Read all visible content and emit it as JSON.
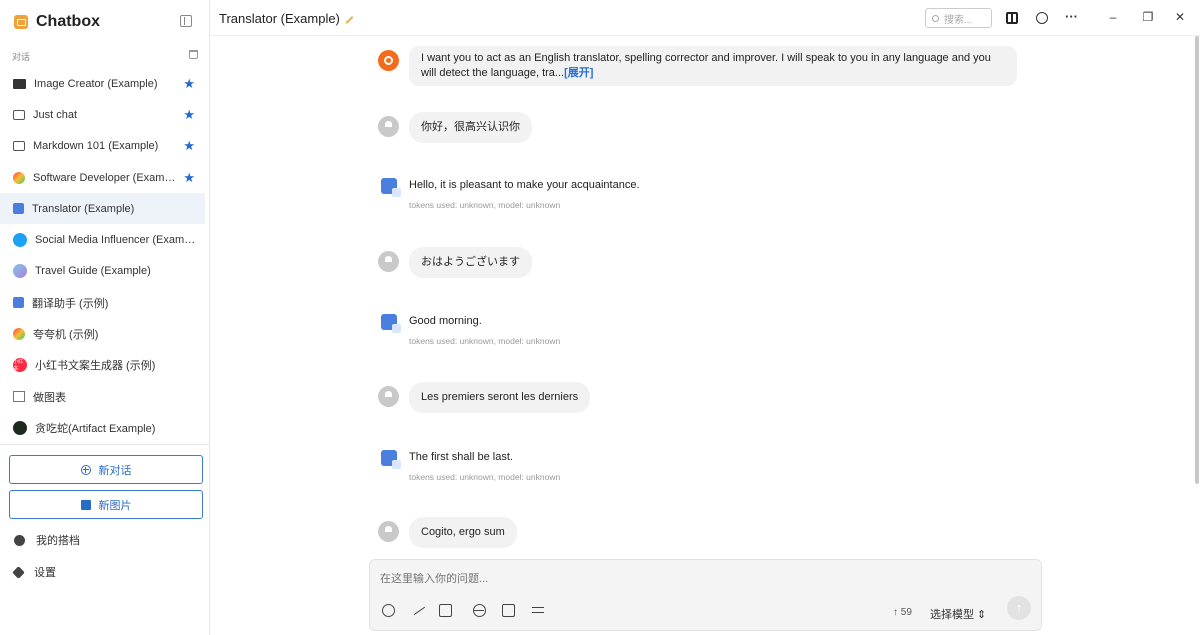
{
  "app": {
    "name": "Chatbox"
  },
  "sidebar": {
    "section_label": "对话",
    "sessions": [
      {
        "label": "Image Creator (Example)",
        "icon": "image-icon",
        "starred": true
      },
      {
        "label": "Just chat",
        "icon": "chat-bubble-icon",
        "starred": true
      },
      {
        "label": "Markdown 101 (Example)",
        "icon": "chat-bubble-icon",
        "starred": true
      },
      {
        "label": "Software Developer (Example)",
        "icon": "developer-avatar-icon",
        "starred": true
      },
      {
        "label": "Translator (Example)",
        "icon": "translator-icon",
        "starred": false,
        "active": true
      },
      {
        "label": "Social Media Influencer (Example)",
        "icon": "twitter-icon",
        "starred": false
      },
      {
        "label": "Travel Guide (Example)",
        "icon": "planet-icon",
        "starred": false
      },
      {
        "label": "翻译助手 (示例)",
        "icon": "translator-icon",
        "starred": false
      },
      {
        "label": "夸夸机 (示例)",
        "icon": "confetti-icon",
        "starred": false
      },
      {
        "label": "小红书文案生成器 (示例)",
        "icon": "xiaohongshu-icon",
        "starred": false
      },
      {
        "label": "做图表",
        "icon": "chart-icon",
        "starred": false
      },
      {
        "label": "贪吃蛇(Artifact Example)",
        "icon": "snake-icon",
        "starred": false
      }
    ],
    "star_glyph": "★",
    "xhs_badge": "小红书",
    "new_chat_label": "新对话",
    "new_image_label": "新图片",
    "my_partners_label": "我的搭档",
    "settings_label": "设置"
  },
  "header": {
    "title": "Translator (Example)",
    "search_placeholder": "搜索...",
    "more_glyph": "···",
    "minimize_glyph": "–",
    "restore_glyph": "❐",
    "close_glyph": "✕"
  },
  "messages": [
    {
      "role": "system",
      "text": "I want you to act as an English translator, spelling corrector and improver. I will speak to you in any language and you will detect the language, tra...",
      "expand_label": "[展开]"
    },
    {
      "role": "user",
      "text": "你好，很高兴认识你"
    },
    {
      "role": "assistant",
      "text": "Hello, it is pleasant to make your acquaintance.",
      "meta": "tokens used: unknown, model: unknown"
    },
    {
      "role": "user",
      "text": "おはようございます"
    },
    {
      "role": "assistant",
      "text": "Good morning.",
      "meta": "tokens used: unknown, model: unknown"
    },
    {
      "role": "user",
      "text": "Les premiers seront les derniers"
    },
    {
      "role": "assistant",
      "text": "The first shall be last.",
      "meta": "tokens used: unknown, model: unknown"
    },
    {
      "role": "user",
      "text": "Cogito, ergo sum"
    }
  ],
  "composer": {
    "placeholder": "在这里输入你的问题...",
    "token_count": "↑ 59",
    "model_select_label": "选择模型 ⇕",
    "send_glyph": "↑"
  }
}
